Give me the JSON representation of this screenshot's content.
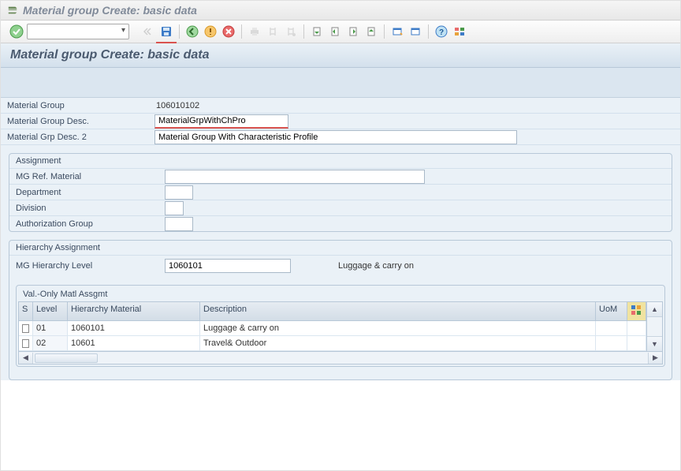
{
  "window": {
    "title": "Material group  Create: basic data"
  },
  "page": {
    "header": "Material group  Create: basic data"
  },
  "form": {
    "matGroup": {
      "label": "Material Group",
      "value": "106010102"
    },
    "matGroupDesc": {
      "label": "Material Group Desc.",
      "value": "MaterialGrpWithChPro"
    },
    "matGrpDesc2": {
      "label": "Material Grp Desc. 2",
      "value": "Material Group With Characteristic Profile"
    }
  },
  "assignment": {
    "title": "Assignment",
    "mgRefMaterial": {
      "label": "MG Ref. Material",
      "value": ""
    },
    "department": {
      "label": "Department",
      "value": ""
    },
    "division": {
      "label": "Division",
      "value": ""
    },
    "authGroup": {
      "label": "Authorization Group",
      "value": ""
    }
  },
  "hierarchy": {
    "title": "Hierarchy Assignment",
    "mgHierLevel": {
      "label": "MG Hierarchy Level",
      "value": "1060101",
      "desc": "Luggage & carry on"
    },
    "subtable": {
      "title": "Val.-Only Matl Assgmt",
      "cols": {
        "s": "S",
        "level": "Level",
        "hm": "Hierarchy Material",
        "desc": "Description",
        "uom": "UoM"
      },
      "rows": [
        {
          "level": "01",
          "hm": "1060101",
          "desc": "Luggage & carry on",
          "uom": ""
        },
        {
          "level": "02",
          "hm": "10601",
          "desc": "Travel& Outdoor",
          "uom": ""
        }
      ]
    }
  }
}
